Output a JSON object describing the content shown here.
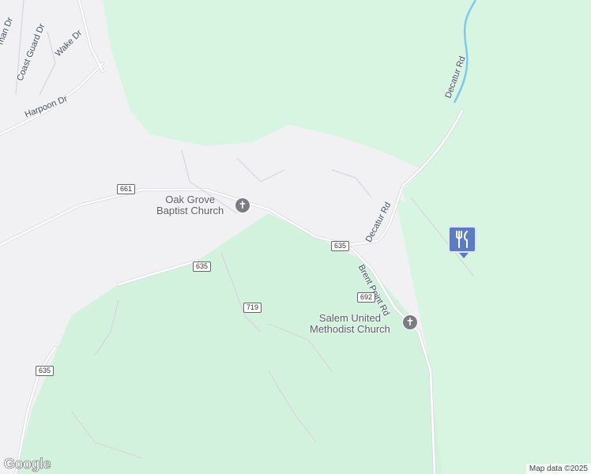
{
  "map": {
    "colors": {
      "land": "#f1f0f3",
      "forest": "#d8f5e2",
      "forest_dark": "#c9efd5",
      "road": "#ffffff",
      "road_casing": "#d6d6dc",
      "water": "#7cc9ef",
      "marker": "#5c7cc2"
    },
    "roads": {
      "decatur_rd_north": "Decatur Rd",
      "decatur_rd_south": "Decatur Rd",
      "brent_point_rd": "Brent Point Rd",
      "harpoon_dr": "Harpoon Dr",
      "coast_guard_dr": "Coast Guard Dr",
      "wake_dr": "Wake Dr",
      "partial_dr": "man Dr"
    },
    "route_shields": {
      "r661": "661",
      "r635_a": "635",
      "r635_b": "635",
      "r635_c": "635",
      "r719": "719",
      "r692": "692"
    },
    "pois": {
      "oak_grove": "Oak Grove\nBaptist Church",
      "salem": "Salem United\nMethodist Church"
    },
    "icons": {
      "church": "church-icon",
      "restaurant": "restaurant-icon"
    },
    "logo": "Google",
    "attribution": "Map data ©2025"
  }
}
